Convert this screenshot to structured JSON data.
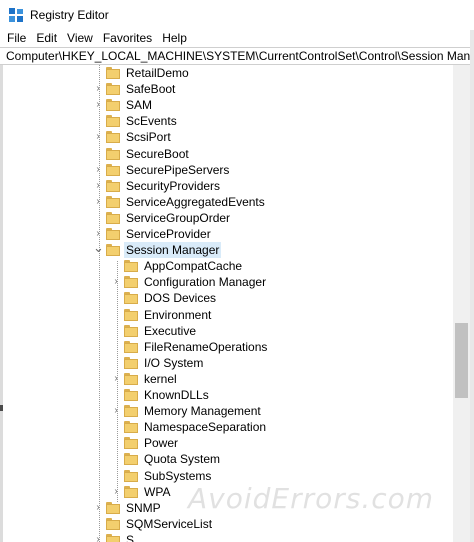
{
  "window": {
    "title": "Registry Editor"
  },
  "menu": [
    "File",
    "Edit",
    "View",
    "Favorites",
    "Help"
  ],
  "address": "Computer\\HKEY_LOCAL_MACHINE\\SYSTEM\\CurrentControlSet\\Control\\Session Manager",
  "tree": {
    "level1": [
      {
        "label": "RetailDemo",
        "expander": ""
      },
      {
        "label": "SafeBoot",
        "expander": "›"
      },
      {
        "label": "SAM",
        "expander": "›"
      },
      {
        "label": "ScEvents",
        "expander": ""
      },
      {
        "label": "ScsiPort",
        "expander": "›"
      },
      {
        "label": "SecureBoot",
        "expander": ""
      },
      {
        "label": "SecurePipeServers",
        "expander": "›"
      },
      {
        "label": "SecurityProviders",
        "expander": "›"
      },
      {
        "label": "ServiceAggregatedEvents",
        "expander": "›"
      },
      {
        "label": "ServiceGroupOrder",
        "expander": ""
      },
      {
        "label": "ServiceProvider",
        "expander": "›"
      },
      {
        "label": "Session Manager",
        "expander": "⌄",
        "selected": true
      }
    ],
    "session_children": [
      {
        "label": "AppCompatCache",
        "expander": ""
      },
      {
        "label": "Configuration Manager",
        "expander": "›"
      },
      {
        "label": "DOS Devices",
        "expander": ""
      },
      {
        "label": "Environment",
        "expander": ""
      },
      {
        "label": "Executive",
        "expander": ""
      },
      {
        "label": "FileRenameOperations",
        "expander": ""
      },
      {
        "label": "I/O System",
        "expander": ""
      },
      {
        "label": "kernel",
        "expander": "›"
      },
      {
        "label": "KnownDLLs",
        "expander": ""
      },
      {
        "label": "Memory Management",
        "expander": "›"
      },
      {
        "label": "NamespaceSeparation",
        "expander": ""
      },
      {
        "label": "Power",
        "expander": ""
      },
      {
        "label": "Quota System",
        "expander": ""
      },
      {
        "label": "SubSystems",
        "expander": ""
      },
      {
        "label": "WPA",
        "expander": "›"
      }
    ],
    "after": [
      {
        "label": "SNMP",
        "expander": "›"
      },
      {
        "label": "SQMServiceList",
        "expander": ""
      },
      {
        "label": "S...",
        "expander": "›"
      }
    ]
  },
  "watermark": "AvoidErrors.com",
  "colors": {
    "selection": "#d9ebf9",
    "folder": "#f3cf6e",
    "app_icon_blue": "#1e73c8"
  }
}
